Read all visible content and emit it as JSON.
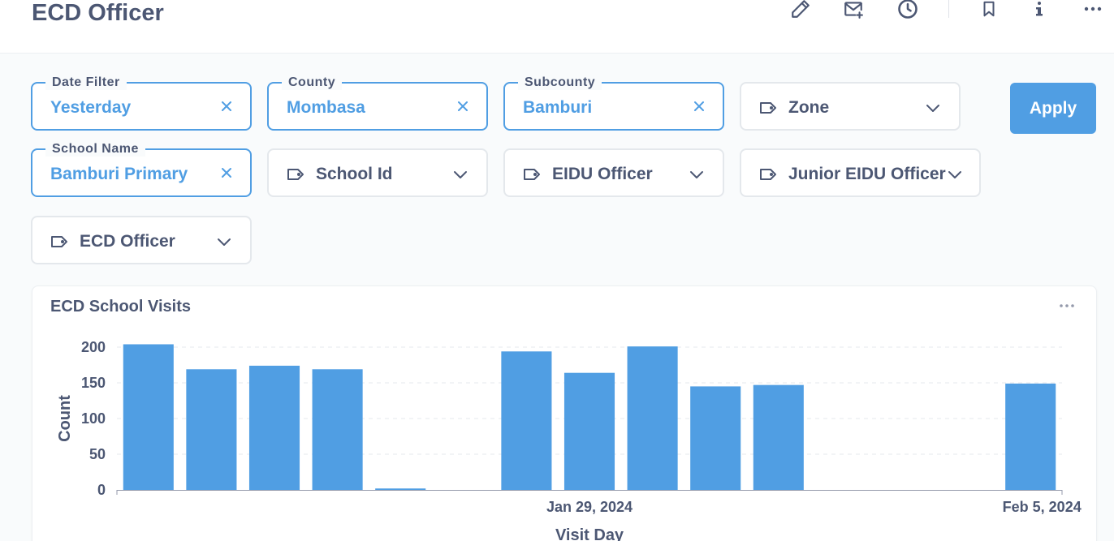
{
  "header": {
    "title": "ECD Officer",
    "icons": [
      "edit-icon",
      "subscribe-mail-icon",
      "history-clock-icon",
      "bookmark-icon",
      "info-icon",
      "more-icon"
    ]
  },
  "filters": [
    {
      "label": "Date Filter",
      "value": "Yesterday",
      "state": "active"
    },
    {
      "label": "County",
      "value": "Mombasa",
      "state": "active"
    },
    {
      "label": "Subcounty",
      "value": "Bamburi",
      "state": "active"
    },
    {
      "placeholder": "Zone",
      "state": "empty"
    },
    {
      "label": "School Name",
      "value": "Bamburi Primary",
      "state": "active"
    },
    {
      "placeholder": "School Id",
      "state": "empty"
    },
    {
      "placeholder": "EIDU Officer",
      "state": "empty"
    },
    {
      "placeholder": "Junior EIDU Officer",
      "state": "empty"
    },
    {
      "placeholder": "ECD Officer",
      "state": "empty"
    }
  ],
  "apply_label": "Apply",
  "card": {
    "title": "ECD School Visits"
  },
  "colors": {
    "accent": "#509ee3",
    "text": "#4c5773",
    "border": "#e4e8ec"
  },
  "chart_data": {
    "type": "bar",
    "title": "ECD School Visits",
    "xlabel": "Visit Day",
    "ylabel": "Count",
    "ylim": [
      0,
      200
    ],
    "yticks": [
      0,
      50,
      100,
      150,
      200
    ],
    "x_tick_labels": [
      {
        "date": "2024-01-29",
        "label": "Jan 29, 2024"
      },
      {
        "date": "2024-02-05",
        "label": "Feb 5, 2024"
      }
    ],
    "x_range": [
      "2024-01-22",
      "2024-02-05"
    ],
    "grid": true,
    "color": "#509ee3",
    "points": [
      {
        "date": "2024-01-22",
        "value": 204
      },
      {
        "date": "2024-01-23",
        "value": 169
      },
      {
        "date": "2024-01-24",
        "value": 174
      },
      {
        "date": "2024-01-25",
        "value": 169
      },
      {
        "date": "2024-01-26",
        "value": 2
      },
      {
        "date": "2024-01-28",
        "value": 194
      },
      {
        "date": "2024-01-29",
        "value": 164
      },
      {
        "date": "2024-01-30",
        "value": 201
      },
      {
        "date": "2024-01-31",
        "value": 145
      },
      {
        "date": "2024-02-01",
        "value": 147
      },
      {
        "date": "2024-02-05",
        "value": 149
      }
    ]
  }
}
